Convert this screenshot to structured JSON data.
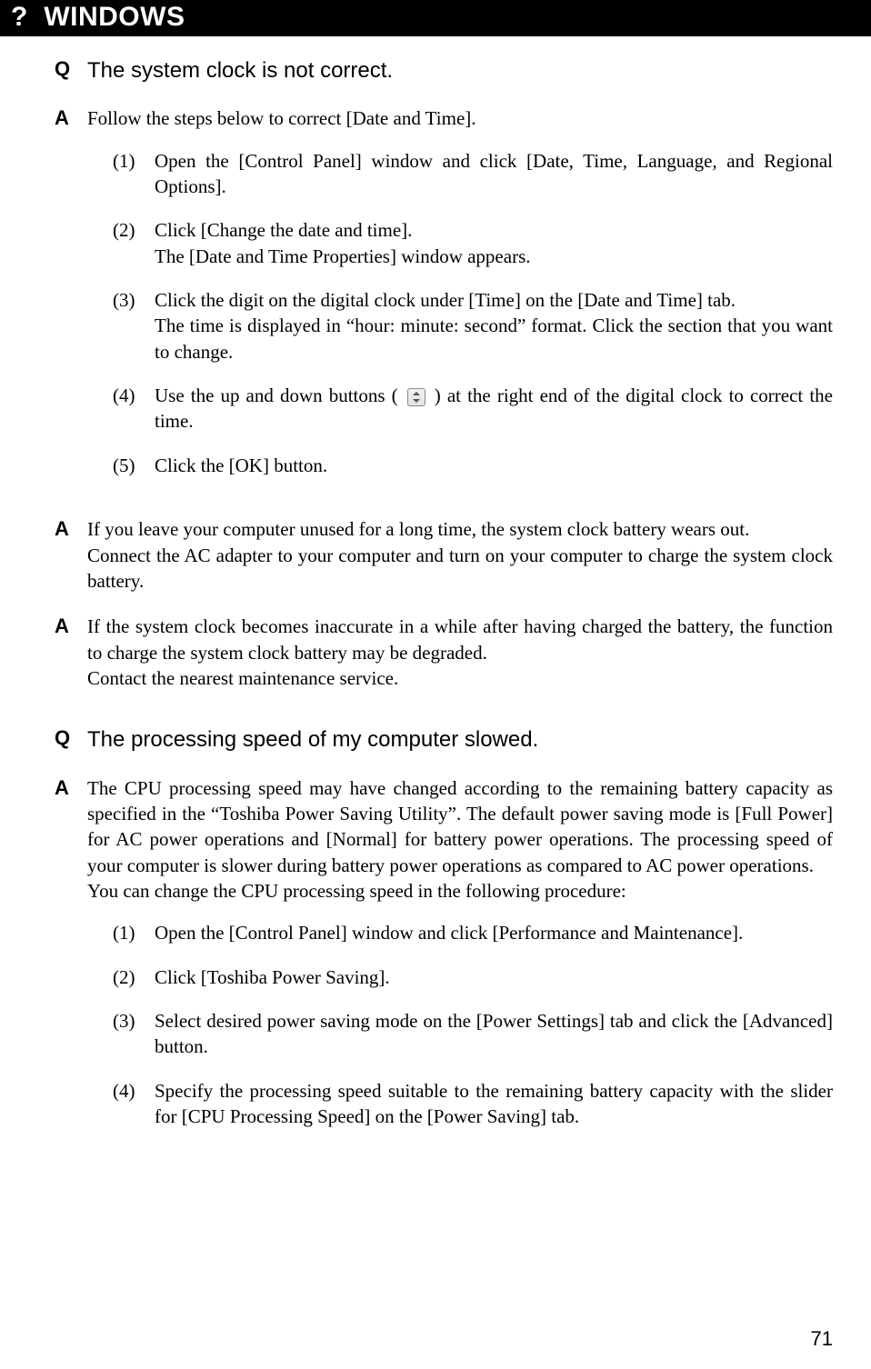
{
  "header": {
    "mark": "?",
    "title": "WINDOWS"
  },
  "q1": {
    "label": "Q",
    "text": "The system clock is not correct."
  },
  "a1": {
    "label": "A",
    "intro": "Follow the steps below to correct [Date and Time].",
    "steps": [
      {
        "num": "(1)",
        "text": "Open the [Control Panel] window and click [Date, Time, Language, and Regional Options]."
      },
      {
        "num": "(2)",
        "text": "Click [Change the date and time].\nThe [Date and Time Properties] window appears."
      },
      {
        "num": "(3)",
        "text": "Click the digit on the digital clock under [Time] on the [Date and Time] tab.\nThe time is displayed in “hour: minute: second” format. Click the section that you want to change."
      },
      {
        "num": "(4)",
        "pre": "Use the up and down buttons ( ",
        "post": " ) at the right end of the digital clock to correct the time."
      },
      {
        "num": "(5)",
        "text": "Click the [OK] button."
      }
    ]
  },
  "a2": {
    "label": "A",
    "text": "If you leave your computer unused for a long time, the system clock battery wears out.\nConnect the AC adapter to your computer and turn on your computer to charge the system clock battery."
  },
  "a3": {
    "label": "A",
    "text": "If the system clock becomes inaccurate in a while after having charged the battery, the function to charge the system clock battery may be degraded.\nContact the nearest maintenance service."
  },
  "q2": {
    "label": "Q",
    "text": "The processing speed of my computer slowed."
  },
  "a4": {
    "label": "A",
    "intro": "The CPU processing speed may have changed according to the remaining battery capacity as specified in the “Toshiba Power Saving Utility”. The default power saving mode is [Full Power] for AC power operations and [Normal] for battery power operations. The processing speed of your computer is slower during battery power operations as compared to AC power operations.\nYou can change the CPU processing speed in the following procedure:",
    "steps": [
      {
        "num": "(1)",
        "text": "Open the [Control Panel] window and click [Performance and Maintenance]."
      },
      {
        "num": "(2)",
        "text": "Click [Toshiba Power Saving]."
      },
      {
        "num": "(3)",
        "text": "Select desired power saving mode on the [Power Settings] tab and click the [Advanced] button."
      },
      {
        "num": "(4)",
        "text": "Specify the processing speed suitable to the remaining battery capacity with the slider for [CPU Processing Speed] on the [Power Saving] tab."
      }
    ]
  },
  "page_number": "71"
}
